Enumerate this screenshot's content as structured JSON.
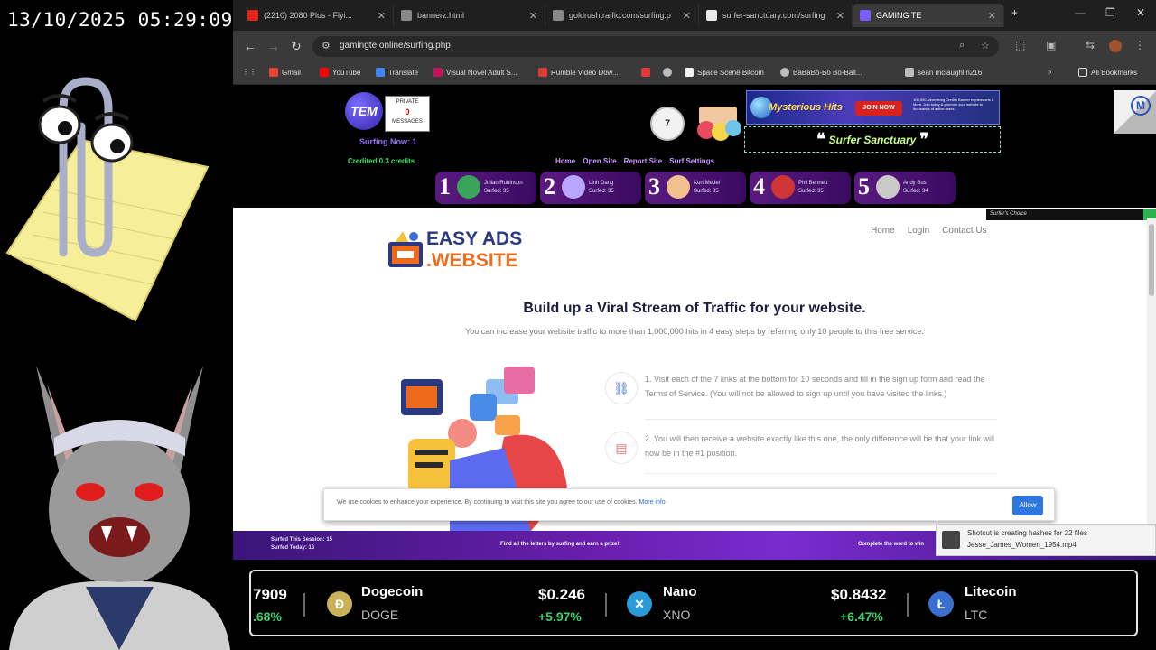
{
  "overlay": {
    "clock": "13/10/2025 05:29:09"
  },
  "browser": {
    "tabs": [
      {
        "title": "(2210) 2080 Plus - Flyi...",
        "color": "#e62117"
      },
      {
        "title": "bannerz.html",
        "color": "#888888"
      },
      {
        "title": "goldrushtraffic.com/surfing.p",
        "color": "#888888"
      },
      {
        "title": "surfer-sanctuary.com/surfing",
        "color": "#e8e8e8"
      },
      {
        "title": "GAMING TE",
        "color": "#7b5cff"
      }
    ],
    "url": "gamingte.online/surfing.php",
    "bookmarks": [
      {
        "label": "Gmail",
        "color": "#ea4335"
      },
      {
        "label": "YouTube",
        "color": "#ff0000"
      },
      {
        "label": "Translate",
        "color": "#4285f4"
      },
      {
        "label": "Visual Novel Adult S...",
        "color": "#c2185b"
      },
      {
        "label": "Rumble Video Dow...",
        "color": "#e53935"
      },
      {
        "label": "",
        "color": "#e53935"
      },
      {
        "label": "",
        "color": "#bdbdbd"
      },
      {
        "label": "Space Scene Bitcoin",
        "color": "#f2f2f2"
      },
      {
        "label": "BaBaBo-Bo Bo-Ball...",
        "color": "#bdbdbd"
      },
      {
        "label": "sean mclaughlin216",
        "color": "#bdbdbd"
      }
    ],
    "all_bookmarks": "All Bookmarks"
  },
  "surfbar": {
    "tem_logo": "TEM",
    "pm_top": "PRIVATE",
    "pm_count": "0",
    "pm_bottom": "MESSAGES",
    "surfing_now": "Surfing Now: 1",
    "credited": "Credited 0.3 credits",
    "timer": "7",
    "banner1_title": "Mysterious Hits",
    "banner1_button": "JOIN NOW",
    "banner1_fine": "100,000 Advertising Credits Banner Impressions & More. Join today & promote your website to thousands of active users.",
    "banner2_title": "Surfer Sanctuary",
    "links": [
      "Home",
      "Open Site",
      "Report Site",
      "Surf Settings"
    ],
    "leaders": [
      {
        "rank": "1",
        "name": "Julian Rubinson",
        "surfed": "Surfed: 35",
        "color": "#3aa55a"
      },
      {
        "rank": "2",
        "name": "Linh Dang",
        "surfed": "Surfed: 35",
        "color": "#b9a6ff"
      },
      {
        "rank": "3",
        "name": "Kurt Medel",
        "surfed": "Surfed: 35",
        "color": "#f0c08e"
      },
      {
        "rank": "4",
        "name": "Phil Bennett",
        "surfed": "Surfed: 35",
        "color": "#d03535"
      },
      {
        "rank": "5",
        "name": "Andy Bus",
        "surfed": "Surfed: 34",
        "color": "#c9c9c9"
      }
    ]
  },
  "site": {
    "surfers_choice": "Surfer's Choice",
    "logo_line1": "EASY ADS",
    "logo_line2": ".WEBSITE",
    "nav": [
      "Home",
      "Login",
      "Contact Us"
    ],
    "headline": "Build up a Viral Stream of Traffic for your website.",
    "subline": "You can increase your website traffic to more than 1,000,000 hits in 4 easy steps by referring only 10 people to this free service.",
    "steps": [
      "1. Visit each of the 7 links at the bottom for 10 seconds and fill in the sign up form and read the Terms of Service. (You will not be allowed to sign up until you have visited the links.)",
      "2. You will then receive a website exactly like this one, the only difference will be that your link will now be in the #1 position."
    ],
    "cookie_text": "We use cookies to enhance your experience. By continuing to visit this site you agree to our use of cookies.",
    "cookie_link": "More info",
    "cookie_button": "Allow"
  },
  "bottombar": {
    "left_line1": "Surfed This Session: 15",
    "left_line2": "Surfed Today: 16",
    "middle": "Find all the letters by surfing and earn a prize!",
    "right": "Complete the word to win"
  },
  "toast": {
    "line1": "Shotcut is creating hashes for 22 files",
    "line2": "Jesse_James_Women_1954.mp4"
  },
  "ticker": {
    "items": [
      {
        "price": "7909",
        "change": ".68%"
      },
      {
        "name": "Dogecoin",
        "symbol": "DOGE",
        "price": "$0.246",
        "change": "+5.97%",
        "color": "#c9b15a",
        "glyph": "Ð"
      },
      {
        "name": "Nano",
        "symbol": "XNO",
        "price": "$0.8432",
        "change": "+6.47%",
        "color": "#2a9ad8",
        "glyph": "✕"
      },
      {
        "name": "Litecoin",
        "symbol": "LTC",
        "color": "#3a6fd0",
        "glyph": "Ł"
      }
    ]
  }
}
